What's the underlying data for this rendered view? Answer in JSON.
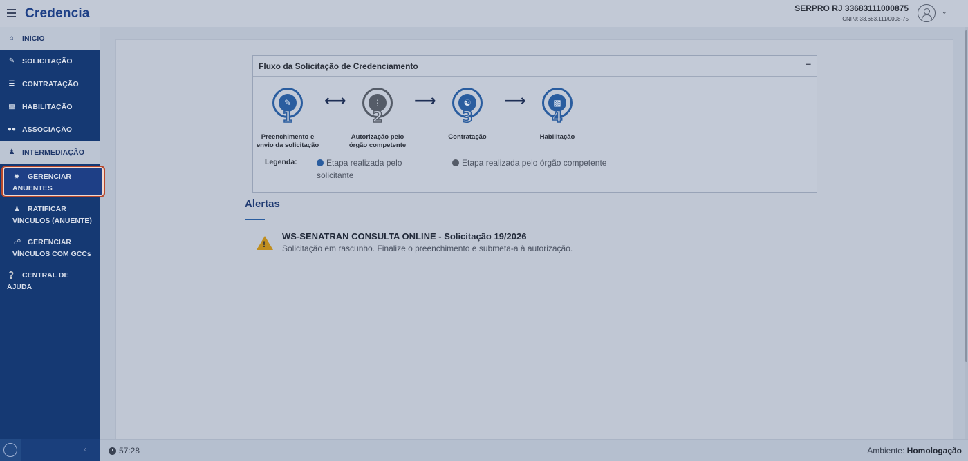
{
  "header": {
    "brand": "Credencia",
    "user_name": "SERPRO RJ 33683111000875",
    "cnpj": "CNPJ: 33.683.111/0008-75"
  },
  "sidebar": {
    "items": [
      {
        "label": "INÍCIO",
        "icon": "home-icon"
      },
      {
        "label": "SOLICITAÇÃO",
        "icon": "edit-icon"
      },
      {
        "label": "CONTRATAÇÃO",
        "icon": "handshake-icon"
      },
      {
        "label": "HABILITAÇÃO",
        "icon": "id-card-icon"
      },
      {
        "label": "ASSOCIAÇÃO",
        "icon": "users-icon"
      },
      {
        "label": "INTERMEDIAÇÃO",
        "icon": "user-tie-icon"
      }
    ],
    "sub_items": [
      {
        "line1": "GERENCIAR",
        "line2": "ANUENTES",
        "icon": "cog-globe-icon"
      },
      {
        "line1": "RATIFICAR",
        "line2": "VÍNCULOS (ANUENTE)",
        "icon": "user-check-icon"
      },
      {
        "line1": "GERENCIAR",
        "line2": "VÍNCULOS COM GCCs",
        "icon": "link-icon"
      }
    ],
    "help": {
      "line1": "CENTRAL DE",
      "line2": "AJUDA",
      "icon": "question-circle-icon"
    }
  },
  "flow": {
    "title": "Fluxo da Solicitação de Credenciamento",
    "minimize": "–",
    "steps": [
      {
        "num": "1",
        "label1": "Preenchimento e",
        "label2": "envio da solicitação",
        "icon": "edit-document-icon"
      },
      {
        "num": "2",
        "label1": "Autorização pelo",
        "label2": "órgão competente",
        "icon": "traffic-light-icon"
      },
      {
        "num": "3",
        "label1": "Contratação",
        "label2": "",
        "icon": "handshake-icon"
      },
      {
        "num": "4",
        "label1": "Habilitação",
        "label2": "",
        "icon": "id-card-icon"
      }
    ],
    "legend_title": "Legenda:",
    "legend_applicant_1": "Etapa realizada pelo",
    "legend_applicant_2": "solicitante",
    "legend_agency": "Etapa realizada pelo órgão competente",
    "colors": {
      "applicant": "#2a5d9f",
      "agency": "#555c68"
    }
  },
  "alerts": {
    "title": "Alertas",
    "items": [
      {
        "title": "WS-SENATRAN CONSULTA ONLINE - Solicitação 19/2026",
        "text": "Solicitação em rascunho. Finalize o preenchimento e submeta-a à autorização.",
        "icon": "warning-icon"
      }
    ]
  },
  "footer": {
    "timer": "57:28",
    "env_label": "Ambiente:",
    "env_value": "Homologação"
  }
}
